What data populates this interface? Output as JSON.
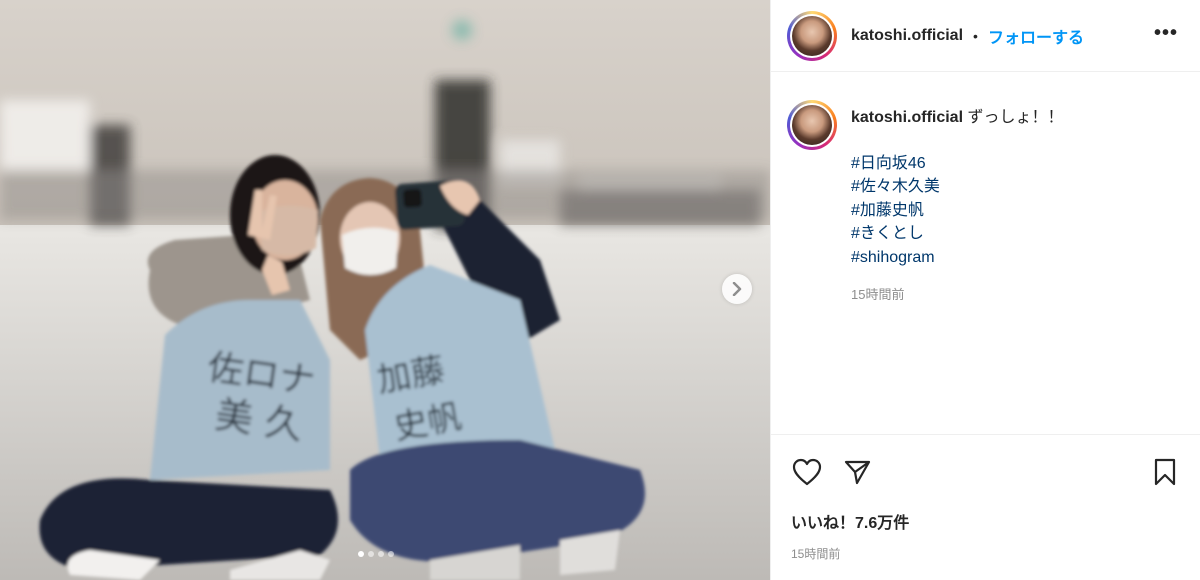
{
  "post": {
    "username": "katoshi.official",
    "separator": "•",
    "follow_label": "フォローする",
    "more_label": "•••",
    "caption": {
      "username": "katoshi.official",
      "text": "ずっしょ！！",
      "hashtags": [
        "#日向坂46",
        "#佐々木久美",
        "#加藤史帆",
        "#きくとし",
        "#shihogram"
      ],
      "timestamp": "15時間前"
    },
    "likes_label": "いいね！7.6万件",
    "timestamp": "15時間前",
    "carousel": {
      "slides": 4,
      "active": 1
    }
  },
  "photo": {
    "jersey_left": [
      "佐々木",
      "久美"
    ],
    "jersey_right": [
      "加藤",
      "史帆"
    ]
  },
  "icons": {
    "like": "heart-icon",
    "share": "paper-plane-icon",
    "save": "bookmark-icon",
    "next": "chevron-right-icon"
  }
}
